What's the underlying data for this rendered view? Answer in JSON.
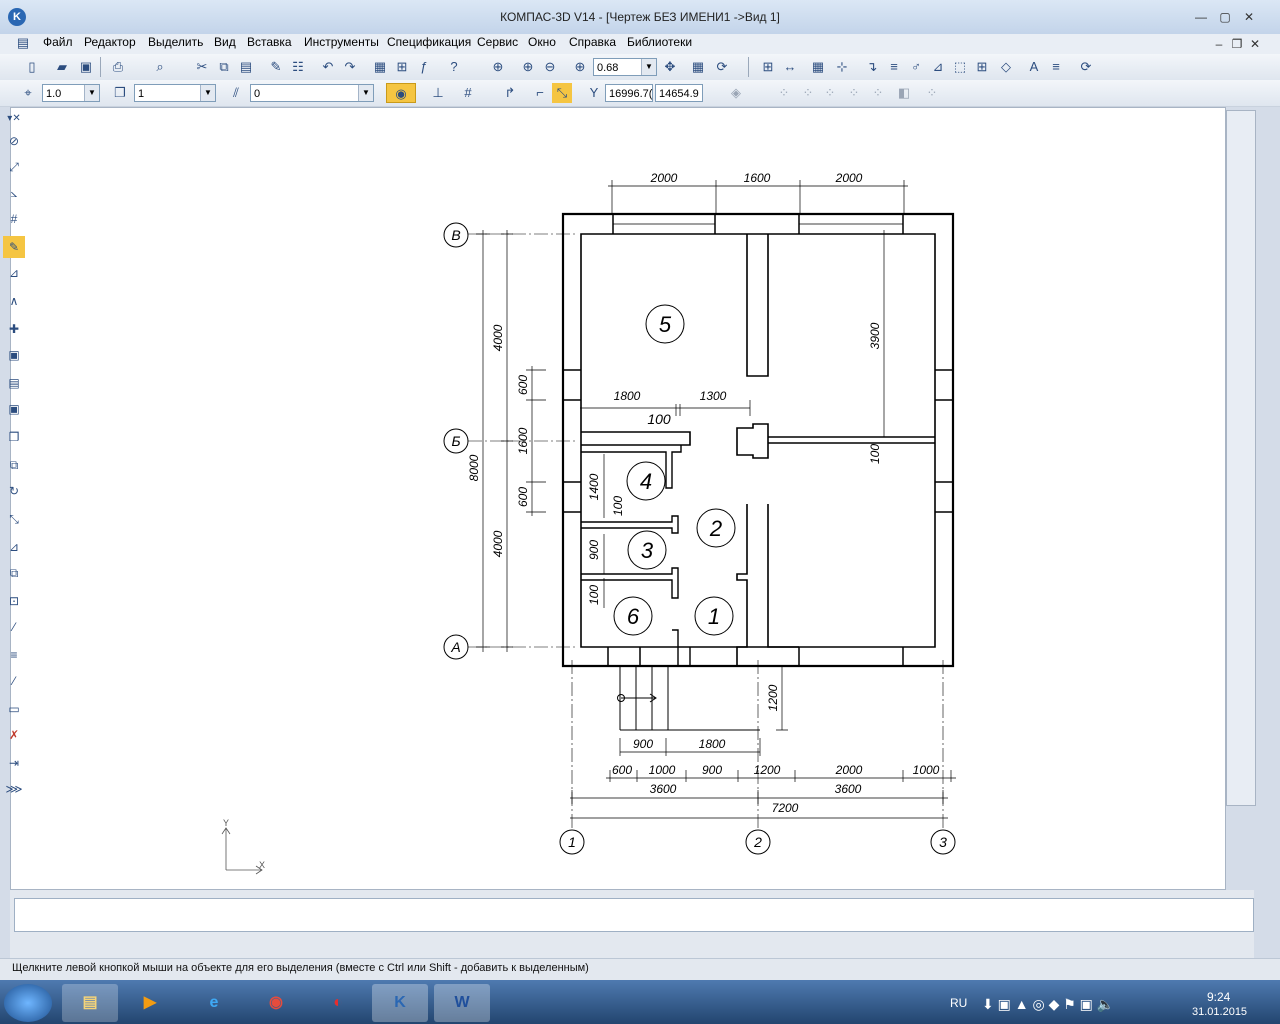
{
  "window": {
    "title": "КОМПАС-3D V14 - [Чертеж БЕЗ ИМЕНИ1 ->Вид 1]",
    "app_icon": "kompas-logo",
    "buttons": [
      "—",
      "▢",
      "✕"
    ]
  },
  "menu": [
    "Файл",
    "Редактор",
    "Выделить",
    "Вид",
    "Вставка",
    "Инструменты",
    "Спецификация",
    "Сервис",
    "Окно",
    "Справка",
    "Библиотеки"
  ],
  "toolbar1": {
    "zoom_value": "0.68"
  },
  "toolbar2": {
    "scale_value": "1.0",
    "layer_value": "1",
    "style_value": "0",
    "coord_x": "16996.7(",
    "coord_y": "14654.9"
  },
  "drawing": {
    "axes_letters": [
      "В",
      "Б",
      "А"
    ],
    "axes_numbers": [
      "1",
      "2",
      "3"
    ],
    "rooms": [
      "5",
      "4",
      "2",
      "3",
      "1",
      "6"
    ],
    "dims_top": [
      "2000",
      "1600",
      "2000"
    ],
    "dims_left_outer": [
      "8000"
    ],
    "dims_left": [
      "4000",
      "4000"
    ],
    "dims_left_inner": [
      "600",
      "1600",
      "600"
    ],
    "dims_inner": [
      "1800",
      "1300",
      "100",
      "3900",
      "100",
      "1400",
      "100",
      "900",
      "100"
    ],
    "dims_bottom1": [
      "900",
      "1800"
    ],
    "dims_bottom2": [
      "600",
      "1000",
      "900",
      "1200",
      "2000",
      "1000"
    ],
    "dims_bottom3": [
      "3600",
      "3600"
    ],
    "dims_total": "7200",
    "dim_stair": "1200",
    "ucs": {
      "x": "X",
      "y": "Y"
    }
  },
  "status": "Щелкните левой кнопкой мыши на объекте для его выделения (вместе с Ctrl или Shift - добавить к выделенным)",
  "taskbar": {
    "lang": "RU",
    "time": "9:24",
    "date": "31.01.2015",
    "apps": [
      "start-icon",
      "explorer-icon",
      "media-player-icon",
      "ie-icon",
      "chrome-icon",
      "app-red-icon",
      "kompas-icon",
      "word-icon"
    ]
  }
}
